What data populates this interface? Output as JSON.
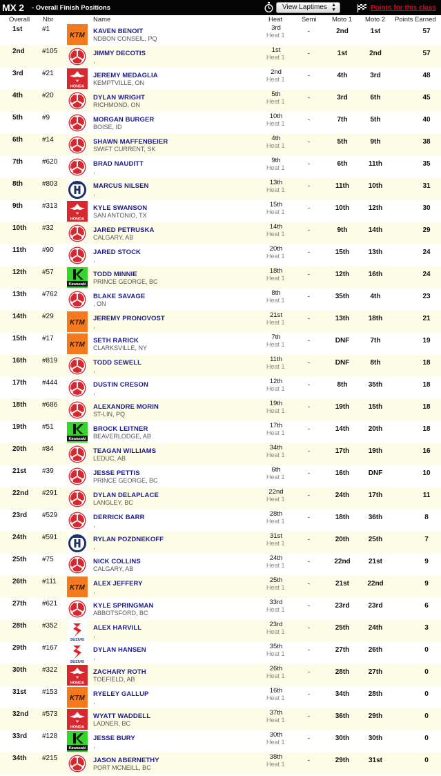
{
  "header": {
    "class": "MX 2",
    "subtitle": "- Overall Finish Positions",
    "view_select": "View Laptimes",
    "points_link": "Points for this class"
  },
  "columns": {
    "overall": "Overall",
    "nbr": "Nbr",
    "name": "Name",
    "heat": "Heat",
    "semi": "Semi",
    "moto1": "Moto 1",
    "moto2": "Moto 2",
    "points": "Points Earned"
  },
  "rows": [
    {
      "pos": "1st",
      "nbr": "#1",
      "brand": "ktm",
      "name": "KAVEN BENOIT",
      "home": "NDBON CONSEIL, PQ",
      "heat": "3rd",
      "heat_label": "Heat 1",
      "semi": "-",
      "m1": "2nd",
      "m2": "1st",
      "pts": "57"
    },
    {
      "pos": "2nd",
      "nbr": "#105",
      "brand": "yamaha",
      "name": "JIMMY DECOTIS",
      "home": ",",
      "heat": "1st",
      "heat_label": "Heat 1",
      "semi": "-",
      "m1": "1st",
      "m2": "2nd",
      "pts": "57"
    },
    {
      "pos": "3rd",
      "nbr": "#21",
      "brand": "honda",
      "name": "JEREMY MEDAGLIA",
      "home": "KEMPTVILLE, ON",
      "heat": "2nd",
      "heat_label": "Heat 1",
      "semi": "-",
      "m1": "4th",
      "m2": "3rd",
      "pts": "48"
    },
    {
      "pos": "4th",
      "nbr": "#20",
      "brand": "yamaha",
      "name": "DYLAN WRIGHT",
      "home": "RICHMOND, ON",
      "heat": "5th",
      "heat_label": "Heat 1",
      "semi": "-",
      "m1": "3rd",
      "m2": "6th",
      "pts": "45"
    },
    {
      "pos": "5th",
      "nbr": "#9",
      "brand": "yamaha",
      "name": "MORGAN BURGER",
      "home": "BOISE, ID",
      "heat": "10th",
      "heat_label": "Heat 1",
      "semi": "-",
      "m1": "7th",
      "m2": "5th",
      "pts": "40"
    },
    {
      "pos": "6th",
      "nbr": "#14",
      "brand": "yamaha",
      "name": "SHAWN MAFFENBEIER",
      "home": "SWIFT CURRENT, SK",
      "heat": "4th",
      "heat_label": "Heat 1",
      "semi": "-",
      "m1": "5th",
      "m2": "9th",
      "pts": "38"
    },
    {
      "pos": "7th",
      "nbr": "#620",
      "brand": "yamaha",
      "name": "BRAD NAUDITT",
      "home": ",",
      "heat": "9th",
      "heat_label": "Heat 1",
      "semi": "-",
      "m1": "6th",
      "m2": "11th",
      "pts": "35"
    },
    {
      "pos": "8th",
      "nbr": "#803",
      "brand": "husqvarna",
      "name": "MARCUS NILSEN",
      "home": ",",
      "heat": "13th",
      "heat_label": "Heat 1",
      "semi": "-",
      "m1": "11th",
      "m2": "10th",
      "pts": "31"
    },
    {
      "pos": "9th",
      "nbr": "#313",
      "brand": "honda",
      "name": "KYLE SWANSON",
      "home": "SAN ANTONIO, TX",
      "heat": "15th",
      "heat_label": "Heat 1",
      "semi": "-",
      "m1": "10th",
      "m2": "12th",
      "pts": "30"
    },
    {
      "pos": "10th",
      "nbr": "#32",
      "brand": "yamaha",
      "name": "JARED PETRUSKA",
      "home": "CALGARY, AB",
      "heat": "14th",
      "heat_label": "Heat 1",
      "semi": "-",
      "m1": "9th",
      "m2": "14th",
      "pts": "29"
    },
    {
      "pos": "11th",
      "nbr": "#90",
      "brand": "yamaha",
      "name": "JARED STOCK",
      "home": ",",
      "heat": "20th",
      "heat_label": "Heat 1",
      "semi": "-",
      "m1": "15th",
      "m2": "13th",
      "pts": "24"
    },
    {
      "pos": "12th",
      "nbr": "#57",
      "brand": "kawasaki",
      "name": "TODD MINNIE",
      "home": "PRINCE GEORGE, BC",
      "heat": "18th",
      "heat_label": "Heat 1",
      "semi": "-",
      "m1": "12th",
      "m2": "16th",
      "pts": "24"
    },
    {
      "pos": "13th",
      "nbr": "#762",
      "brand": "yamaha",
      "name": "BLAKE SAVAGE",
      "home": ", ON",
      "heat": "8th",
      "heat_label": "Heat 1",
      "semi": "-",
      "m1": "35th",
      "m2": "4th",
      "pts": "23"
    },
    {
      "pos": "14th",
      "nbr": "#29",
      "brand": "ktm",
      "name": "JEREMY PRONOVOST",
      "home": ",",
      "heat": "21st",
      "heat_label": "Heat 1",
      "semi": "-",
      "m1": "13th",
      "m2": "18th",
      "pts": "21"
    },
    {
      "pos": "15th",
      "nbr": "#17",
      "brand": "ktm",
      "name": "SETH RARICK",
      "home": "CLARKSVILLE, NY",
      "heat": "7th",
      "heat_label": "Heat 1",
      "semi": "-",
      "m1": "DNF",
      "m2": "7th",
      "pts": "19"
    },
    {
      "pos": "16th",
      "nbr": "#819",
      "brand": "yamaha",
      "name": "TODD SEWELL",
      "home": ",",
      "heat": "11th",
      "heat_label": "Heat 1",
      "semi": "-",
      "m1": "DNF",
      "m2": "8th",
      "pts": "18"
    },
    {
      "pos": "17th",
      "nbr": "#444",
      "brand": "yamaha",
      "name": "DUSTIN CRESON",
      "home": ",",
      "heat": "12th",
      "heat_label": "Heat 1",
      "semi": "-",
      "m1": "8th",
      "m2": "35th",
      "pts": "18"
    },
    {
      "pos": "18th",
      "nbr": "#686",
      "brand": "yamaha",
      "name": "ALEXANDRE MORIN",
      "home": "ST-LIN, PQ",
      "heat": "19th",
      "heat_label": "Heat 1",
      "semi": "-",
      "m1": "19th",
      "m2": "15th",
      "pts": "18"
    },
    {
      "pos": "19th",
      "nbr": "#51",
      "brand": "kawasaki",
      "name": "BROCK LEITNER",
      "home": "BEAVERLODGE, AB",
      "heat": "17th",
      "heat_label": "Heat 1",
      "semi": "-",
      "m1": "14th",
      "m2": "20th",
      "pts": "18"
    },
    {
      "pos": "20th",
      "nbr": "#84",
      "brand": "yamaha",
      "name": "TEAGAN WILLIAMS",
      "home": "LEDUC, AB",
      "heat": "34th",
      "heat_label": "Heat 1",
      "semi": "-",
      "m1": "17th",
      "m2": "19th",
      "pts": "16"
    },
    {
      "pos": "21st",
      "nbr": "#39",
      "brand": "yamaha",
      "name": "JESSE PETTIS",
      "home": "PRINCE GEORGE, BC",
      "heat": "6th",
      "heat_label": "Heat 1",
      "semi": "-",
      "m1": "16th",
      "m2": "DNF",
      "pts": "10"
    },
    {
      "pos": "22nd",
      "nbr": "#291",
      "brand": "yamaha",
      "name": "DYLAN DELAPLACE",
      "home": "LANGLEY, BC",
      "heat": "22nd",
      "heat_label": "Heat 1",
      "semi": "-",
      "m1": "24th",
      "m2": "17th",
      "pts": "11"
    },
    {
      "pos": "23rd",
      "nbr": "#529",
      "brand": "yamaha",
      "name": "DERRICK BARR",
      "home": ",",
      "heat": "28th",
      "heat_label": "Heat 1",
      "semi": "-",
      "m1": "18th",
      "m2": "36th",
      "pts": "8"
    },
    {
      "pos": "24th",
      "nbr": "#591",
      "brand": "husqvarna",
      "name": "RYLAN POZDNEKOFF",
      "home": ",",
      "heat": "31st",
      "heat_label": "Heat 1",
      "semi": "-",
      "m1": "20th",
      "m2": "25th",
      "pts": "7"
    },
    {
      "pos": "25th",
      "nbr": "#75",
      "brand": "yamaha",
      "name": "NICK COLLINS",
      "home": "CALGARY, AB",
      "heat": "24th",
      "heat_label": "Heat 1",
      "semi": "-",
      "m1": "22nd",
      "m2": "21st",
      "pts": "9"
    },
    {
      "pos": "26th",
      "nbr": "#111",
      "brand": "ktm",
      "name": "ALEX JEFFERY",
      "home": ",",
      "heat": "25th",
      "heat_label": "Heat 1",
      "semi": "-",
      "m1": "21st",
      "m2": "22nd",
      "pts": "9"
    },
    {
      "pos": "27th",
      "nbr": "#621",
      "brand": "yamaha",
      "name": "KYLE SPRINGMAN",
      "home": "ABBOTSFORD, BC",
      "heat": "33rd",
      "heat_label": "Heat 1",
      "semi": "-",
      "m1": "23rd",
      "m2": "23rd",
      "pts": "6"
    },
    {
      "pos": "28th",
      "nbr": "#352",
      "brand": "suzuki",
      "name": "ALEX HARVILL",
      "home": ",",
      "heat": "23rd",
      "heat_label": "Heat 1",
      "semi": "-",
      "m1": "25th",
      "m2": "24th",
      "pts": "3"
    },
    {
      "pos": "29th",
      "nbr": "#167",
      "brand": "suzuki",
      "name": "DYLAN HANSEN",
      "home": ",",
      "heat": "35th",
      "heat_label": "Heat 1",
      "semi": "-",
      "m1": "27th",
      "m2": "26th",
      "pts": "0"
    },
    {
      "pos": "30th",
      "nbr": "#322",
      "brand": "honda",
      "name": "ZACHARY ROTH",
      "home": "TOEFIELD, AB",
      "heat": "26th",
      "heat_label": "Heat 1",
      "semi": "-",
      "m1": "28th",
      "m2": "27th",
      "pts": "0"
    },
    {
      "pos": "31st",
      "nbr": "#153",
      "brand": "ktm",
      "name": "RYELEY GALLUP",
      "home": ",",
      "heat": "16th",
      "heat_label": "Heat 1",
      "semi": "-",
      "m1": "34th",
      "m2": "28th",
      "pts": "0"
    },
    {
      "pos": "32nd",
      "nbr": "#573",
      "brand": "honda",
      "name": "WYATT WADDELL",
      "home": "LADNER, BC",
      "heat": "37th",
      "heat_label": "Heat 1",
      "semi": "-",
      "m1": "36th",
      "m2": "29th",
      "pts": "0"
    },
    {
      "pos": "33rd",
      "nbr": "#128",
      "brand": "kawasaki",
      "name": "JESSE BURY",
      "home": ",",
      "heat": "30th",
      "heat_label": "Heat 1",
      "semi": "-",
      "m1": "30th",
      "m2": "30th",
      "pts": "0"
    },
    {
      "pos": "34th",
      "nbr": "#215",
      "brand": "yamaha",
      "name": "JASON ABERNETHY",
      "home": "PORT MCNEILL, BC",
      "heat": "38th",
      "heat_label": "Heat 1",
      "semi": "-",
      "m1": "29th",
      "m2": "31st",
      "pts": "0"
    }
  ],
  "brand_logos": {
    "ktm": {
      "icon": "ktm-logo-icon",
      "text": "KTM",
      "bg": "#f47a20",
      "fg": "#1a1a1a"
    },
    "yamaha": {
      "icon": "yamaha-logo-icon",
      "bg": "#d8282f"
    },
    "honda": {
      "icon": "honda-logo-icon",
      "text": "HONDA",
      "bg": "#d8282f"
    },
    "husqvarna": {
      "icon": "husqvarna-logo-icon",
      "bg": "#1d2f6b"
    },
    "kawasaki": {
      "icon": "kawasaki-logo-icon",
      "text": "Kawasaki",
      "bg": "#35d62a"
    },
    "suzuki": {
      "icon": "suzuki-logo-icon",
      "text": "SUZUKI",
      "bg": "#e01e2a"
    }
  }
}
